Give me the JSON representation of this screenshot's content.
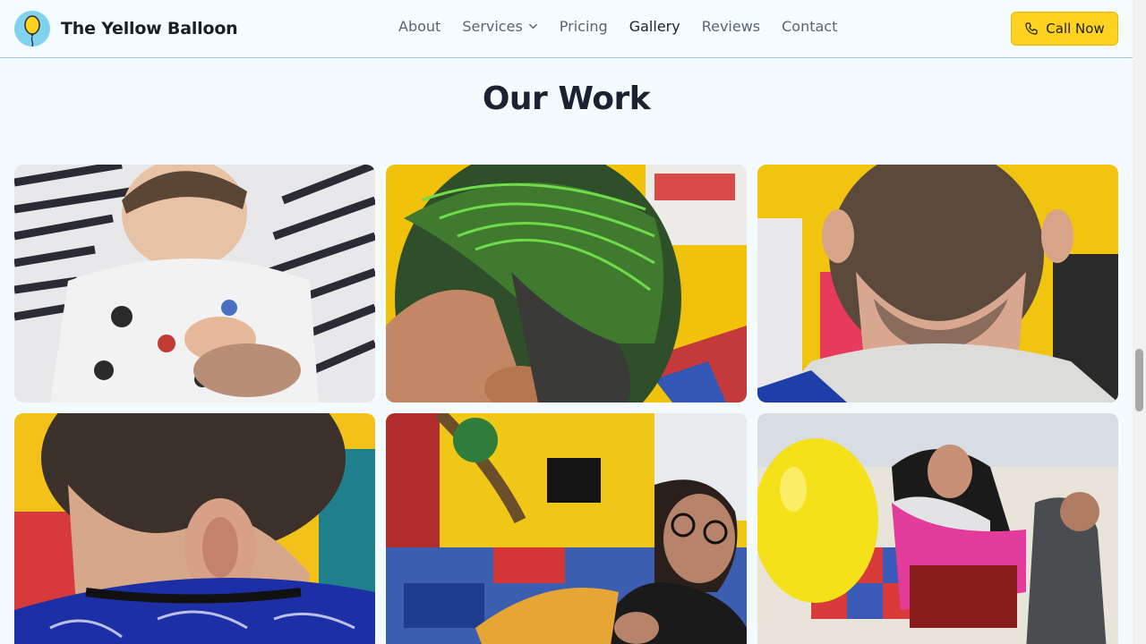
{
  "brand": {
    "name": "The Yellow Balloon",
    "logo_icon": "balloon-icon"
  },
  "nav": {
    "items": [
      {
        "label": "About"
      },
      {
        "label": "Services",
        "has_dropdown": true
      },
      {
        "label": "Pricing"
      },
      {
        "label": "Gallery",
        "active": true
      },
      {
        "label": "Reviews"
      },
      {
        "label": "Contact"
      }
    ]
  },
  "cta": {
    "label": "Call Now",
    "icon": "phone-icon"
  },
  "section": {
    "title": "Our Work"
  },
  "gallery": {
    "photos": [
      {
        "name": "toddler-in-cape-photo"
      },
      {
        "name": "green-highlight-haircut-photo"
      },
      {
        "name": "tapered-neckline-photo"
      },
      {
        "name": "boy-fade-haircut-photo"
      },
      {
        "name": "stylist-cutting-hair-photo"
      },
      {
        "name": "salon-balloon-photo"
      }
    ]
  },
  "colors": {
    "accent": "#fdd31f",
    "background": "#f3fbfe",
    "text": "#1b2232"
  }
}
